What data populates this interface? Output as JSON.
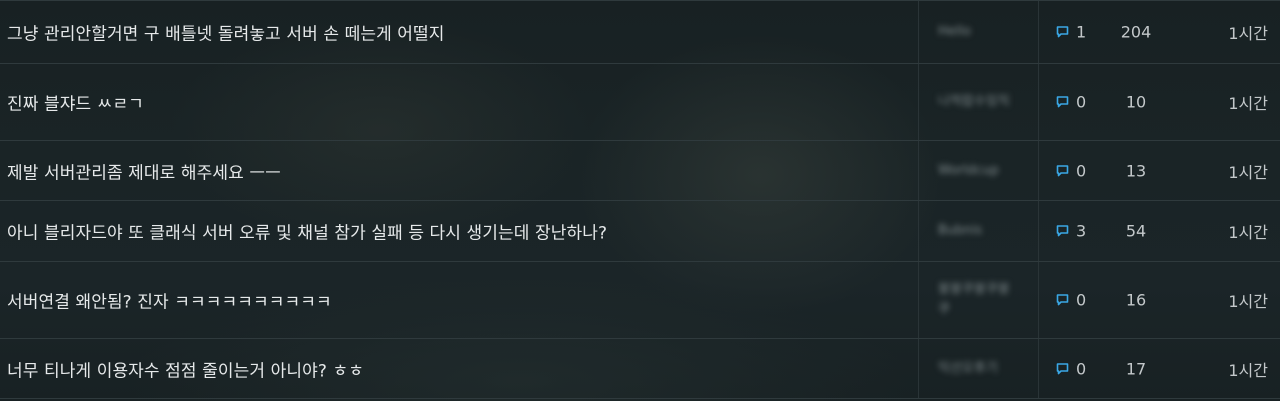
{
  "topics": [
    {
      "title": "그냥 관리안할거면 구 배틀넷 돌려놓고 서버 손 떼는게 어떨지",
      "author": "Hello",
      "replies": "1",
      "views": "204",
      "time": "1시간"
    },
    {
      "title": "진짜 블쟈드 ㅆㄹㄱ",
      "author": "나적랍수잉직",
      "replies": "0",
      "views": "10",
      "time": "1시간"
    },
    {
      "title": "제발 서버관리좀 제대로 해주세요 ㅡㅡ",
      "author": "Worldcup",
      "replies": "0",
      "views": "13",
      "time": "1시간"
    },
    {
      "title": "아니 블리자드야 또 클래식 서버 오류 및 채널 참가 실패 등 다시 생기는데 장난하나?",
      "author": "Bubnis",
      "replies": "3",
      "views": "54",
      "time": "1시간"
    },
    {
      "title": "서버연결 왜안됨? 진자 ㅋㅋㅋㅋㅋㅋㅋㅋㅋㅋ",
      "author": "붕붕쿠붕쿠붕쿠",
      "replies": "0",
      "views": "16",
      "time": "1시간"
    },
    {
      "title": "너무 티나게 이용자수 점점 줄이는거 아니야? ㅎㅎ",
      "author": "익선오후기",
      "replies": "0",
      "views": "17",
      "time": "1시간"
    }
  ],
  "colors": {
    "background": "#1a2426",
    "text": "#e6e9ea",
    "muted": "#c3c8ca",
    "reply_icon": "#3aa8e6",
    "divider": "#2f3a3d"
  },
  "icons": {
    "reply": "speech-bubble-icon"
  }
}
